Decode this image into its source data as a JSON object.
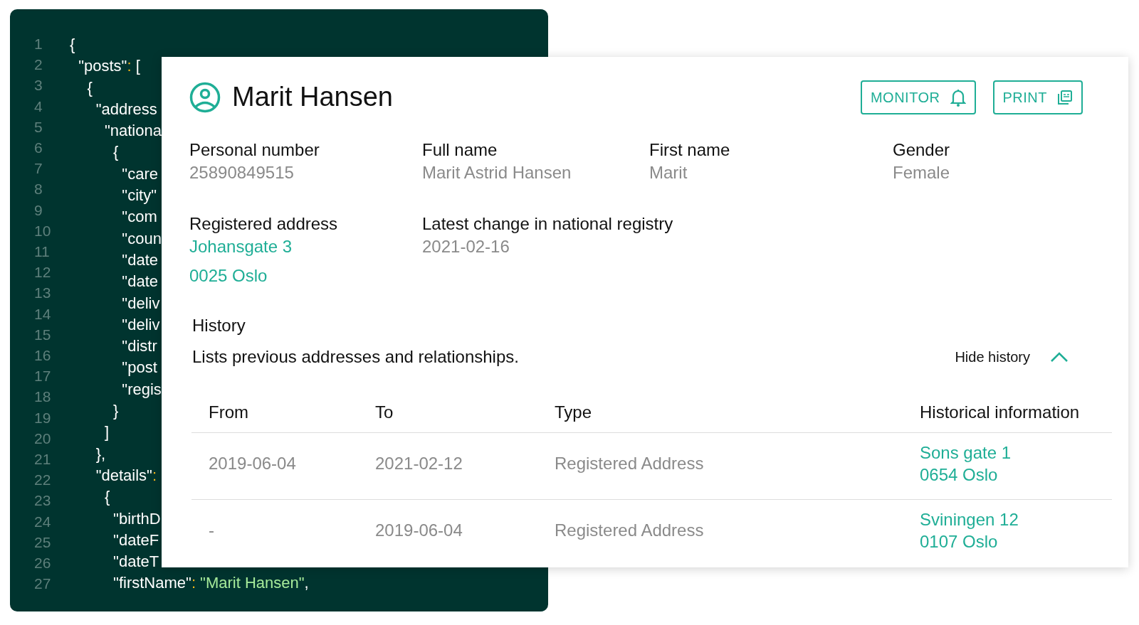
{
  "code_editor": {
    "line_numbers": [
      "1",
      "2",
      "3",
      "4",
      "5",
      "6",
      "7",
      "8",
      "9",
      "10",
      "11",
      "12",
      "13",
      "14",
      "15",
      "16",
      "17",
      "18",
      "19",
      "20",
      "21",
      "22",
      "23",
      "24",
      "25",
      "26",
      "27"
    ],
    "lines": [
      {
        "parts": [
          {
            "kind": "plain",
            "text": "{"
          }
        ]
      },
      {
        "parts": [
          {
            "kind": "key",
            "text": "  \"posts\""
          },
          {
            "kind": "punct",
            "text": ":"
          },
          {
            "kind": "plain",
            "text": " ["
          }
        ]
      },
      {
        "parts": [
          {
            "kind": "plain",
            "text": "    {"
          }
        ]
      },
      {
        "parts": [
          {
            "kind": "key",
            "text": "      \"address"
          }
        ]
      },
      {
        "parts": [
          {
            "kind": "key",
            "text": "        \"nationa"
          }
        ]
      },
      {
        "parts": [
          {
            "kind": "plain",
            "text": "          {"
          }
        ]
      },
      {
        "parts": [
          {
            "kind": "key",
            "text": "            \"care"
          }
        ]
      },
      {
        "parts": [
          {
            "kind": "key",
            "text": "            \"city\""
          }
        ]
      },
      {
        "parts": [
          {
            "kind": "key",
            "text": "            \"com"
          }
        ]
      },
      {
        "parts": [
          {
            "kind": "key",
            "text": "            \"coun"
          }
        ]
      },
      {
        "parts": [
          {
            "kind": "key",
            "text": "            \"date"
          }
        ]
      },
      {
        "parts": [
          {
            "kind": "key",
            "text": "            \"date"
          }
        ]
      },
      {
        "parts": [
          {
            "kind": "key",
            "text": "            \"deliv"
          }
        ]
      },
      {
        "parts": [
          {
            "kind": "key",
            "text": "            \"deliv"
          }
        ]
      },
      {
        "parts": [
          {
            "kind": "key",
            "text": "            \"distr"
          }
        ]
      },
      {
        "parts": [
          {
            "kind": "key",
            "text": "            \"post"
          }
        ]
      },
      {
        "parts": [
          {
            "kind": "key",
            "text": "            \"regis"
          }
        ]
      },
      {
        "parts": [
          {
            "kind": "plain",
            "text": "          }"
          }
        ]
      },
      {
        "parts": [
          {
            "kind": "plain",
            "text": "        ]"
          }
        ]
      },
      {
        "parts": [
          {
            "kind": "plain",
            "text": "      },"
          }
        ]
      },
      {
        "parts": [
          {
            "kind": "key",
            "text": "      \"details\""
          },
          {
            "kind": "punct",
            "text": ":"
          }
        ]
      },
      {
        "parts": [
          {
            "kind": "plain",
            "text": "        {"
          }
        ]
      },
      {
        "parts": [
          {
            "kind": "key",
            "text": "          \"birthD"
          }
        ]
      },
      {
        "parts": [
          {
            "kind": "key",
            "text": "          \"dateF"
          }
        ]
      },
      {
        "parts": [
          {
            "kind": "key",
            "text": "          \"dateT"
          }
        ]
      },
      {
        "parts": [
          {
            "kind": "key",
            "text": "          \"firstName\""
          },
          {
            "kind": "punct",
            "text": ":"
          },
          {
            "kind": "string",
            "text": " \"Marit Hansen\""
          },
          {
            "kind": "plain",
            "text": ","
          }
        ]
      }
    ]
  },
  "person_card": {
    "title": "Marit Hansen",
    "buttons": [
      {
        "label": "MONITOR"
      },
      {
        "label": "PRINT"
      }
    ],
    "fields": [
      {
        "label": "Personal number",
        "values": [
          {
            "kind": "plain",
            "text": "25890849515"
          }
        ]
      },
      {
        "label": "Full name",
        "values": [
          {
            "kind": "plain",
            "text": "Marit Astrid Hansen"
          }
        ]
      },
      {
        "label": "First name",
        "values": [
          {
            "kind": "plain",
            "text": "Marit"
          }
        ]
      },
      {
        "label": "Gender",
        "values": [
          {
            "kind": "plain",
            "text": "Female"
          }
        ]
      },
      {
        "label": "Registered address",
        "values": [
          {
            "kind": "link",
            "text": "Johansgate 3"
          },
          {
            "kind": "link",
            "text": "0025 Oslo"
          }
        ]
      },
      {
        "label": "Latest change in national registry",
        "values": [
          {
            "kind": "plain",
            "text": "2021-02-16"
          }
        ]
      }
    ],
    "history": {
      "title": "History",
      "description": "Lists previous addresses and relationships.",
      "toggle": {
        "label": "Hide history",
        "expanded": true
      },
      "table": {
        "columns": [
          "From",
          "To",
          "Type",
          "Historical information"
        ],
        "rows": [
          {
            "cells": [
              "2019-06-04",
              "2021-02-12",
              "Registered Address"
            ],
            "info": [
              "Sons gate 1",
              "0654 Oslo"
            ]
          },
          {
            "cells": [
              "-",
              "2019-06-04",
              "Registered Address"
            ],
            "info": [
              "Sviningen 12",
              "0107 Oslo"
            ]
          }
        ]
      }
    }
  }
}
